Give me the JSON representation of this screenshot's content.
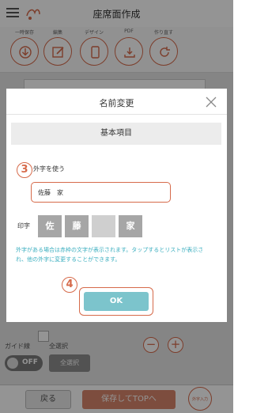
{
  "app": {
    "title": "座席面作成",
    "toolbar": [
      {
        "label": "一時保存",
        "icon": "download-icon"
      },
      {
        "label": "編集",
        "icon": "edit-icon"
      },
      {
        "label": "デザイン",
        "icon": "phone-icon"
      },
      {
        "label": "PDF",
        "icon": "pdf-download-icon"
      },
      {
        "label": "作り直す",
        "icon": "refresh-icon"
      }
    ],
    "guide_label": "ガイド線",
    "guide_toggle": "OFF",
    "select_all_label": "全選択",
    "select_all_button": "全選択",
    "back_button": "戻る",
    "save_top_button": "保存してTOPへ",
    "gaiji_button": "外字入力"
  },
  "dialog": {
    "title": "名前変更",
    "section": "基本項目",
    "step3": "3",
    "use_gaiji": "外字を使う",
    "name_value": "佐藤　家",
    "inji_label": "印字",
    "chars": [
      "佐",
      "藤",
      "",
      "家"
    ],
    "help": "外字がある場合は赤枠の文字が表示されます。タップするとリストが表示され、他の外字に変更することができます。",
    "step4": "4",
    "ok": "OK"
  },
  "colors": {
    "accent": "#d66a4a",
    "ok": "#7cc4cc",
    "help": "#3aaebf"
  }
}
